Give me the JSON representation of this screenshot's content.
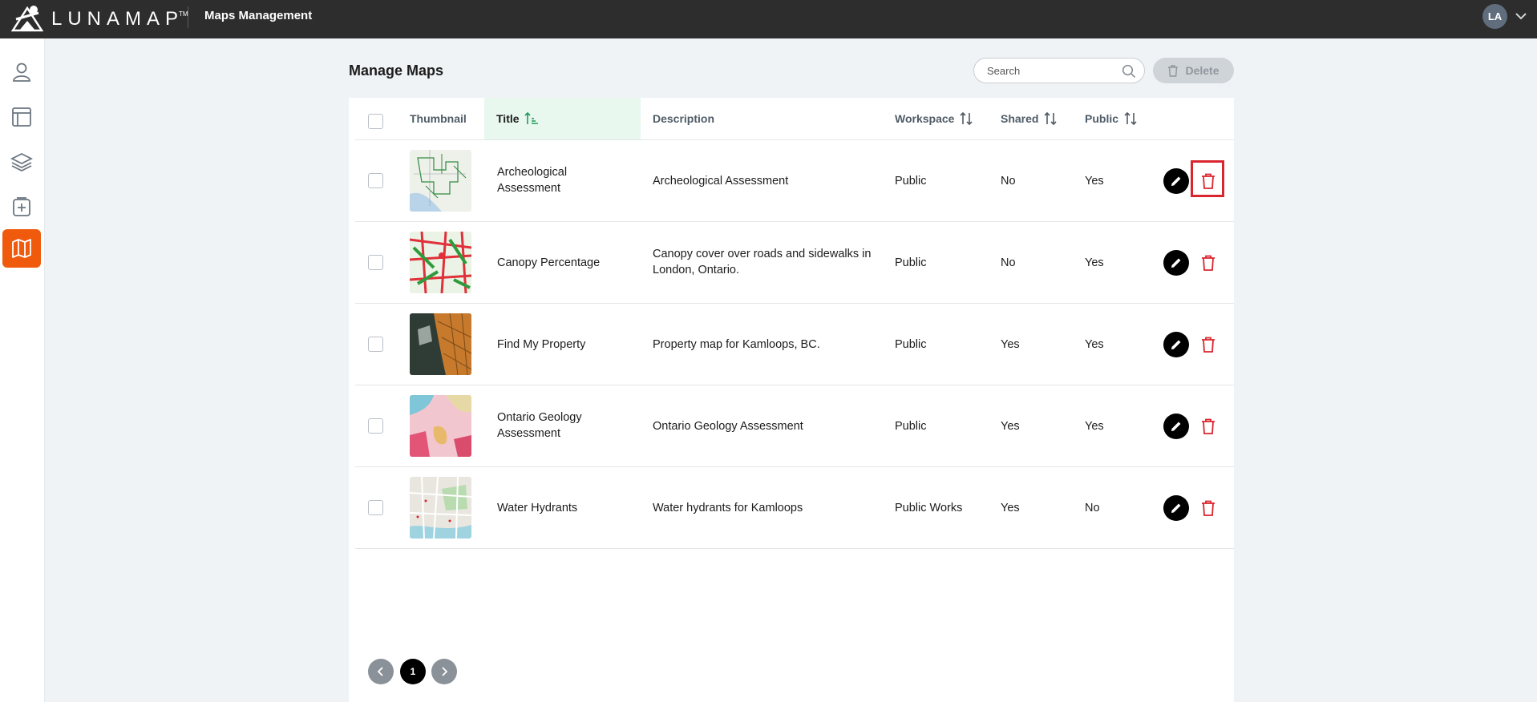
{
  "app": {
    "brand": "LUNAMAP",
    "trademark": "TM",
    "title": "Maps Management"
  },
  "user": {
    "initials": "LA"
  },
  "sidebar": {
    "items": [
      {
        "icon": "user-icon",
        "active": false
      },
      {
        "icon": "layout-icon",
        "active": false
      },
      {
        "icon": "layers-icon",
        "active": false
      },
      {
        "icon": "add-icon",
        "active": false
      },
      {
        "icon": "map-icon",
        "active": true
      }
    ],
    "active_color": "#f05a0d"
  },
  "page": {
    "title": "Manage Maps"
  },
  "search": {
    "placeholder": "Search",
    "value": ""
  },
  "toolbar": {
    "delete_label": "Delete"
  },
  "table": {
    "columns": {
      "thumbnail": "Thumbnail",
      "title": "Title",
      "description": "Description",
      "workspace": "Workspace",
      "shared": "Shared",
      "public": "Public"
    },
    "sorted_column": "title",
    "rows": [
      {
        "title": "Archeological Assessment",
        "description": "Archeological Assessment",
        "workspace": "Public",
        "shared": "No",
        "public": "Yes",
        "thumbnail": "outline-map"
      },
      {
        "title": "Canopy Percentage",
        "description": "Canopy cover over roads and sidewalks in London, Ontario.",
        "workspace": "Public",
        "shared": "No",
        "public": "Yes",
        "thumbnail": "canopy-map"
      },
      {
        "title": "Find My Property",
        "description": "Property map for Kamloops, BC.",
        "workspace": "Public",
        "shared": "Yes",
        "public": "Yes",
        "thumbnail": "property-map"
      },
      {
        "title": "Ontario Geology Assessment",
        "description": "Ontario Geology Assessment",
        "workspace": "Public",
        "shared": "Yes",
        "public": "Yes",
        "thumbnail": "geology-map"
      },
      {
        "title": "Water Hydrants",
        "description": "Water hydrants for Kamloops",
        "workspace": "Public Works",
        "shared": "Yes",
        "public": "No",
        "thumbnail": "street-map"
      }
    ]
  },
  "pagination": {
    "current_page": "1"
  },
  "colors": {
    "topbar": "#2d2d2d",
    "delete_red": "#d9262e",
    "sorted_header_bg": "#e8f8ef"
  }
}
